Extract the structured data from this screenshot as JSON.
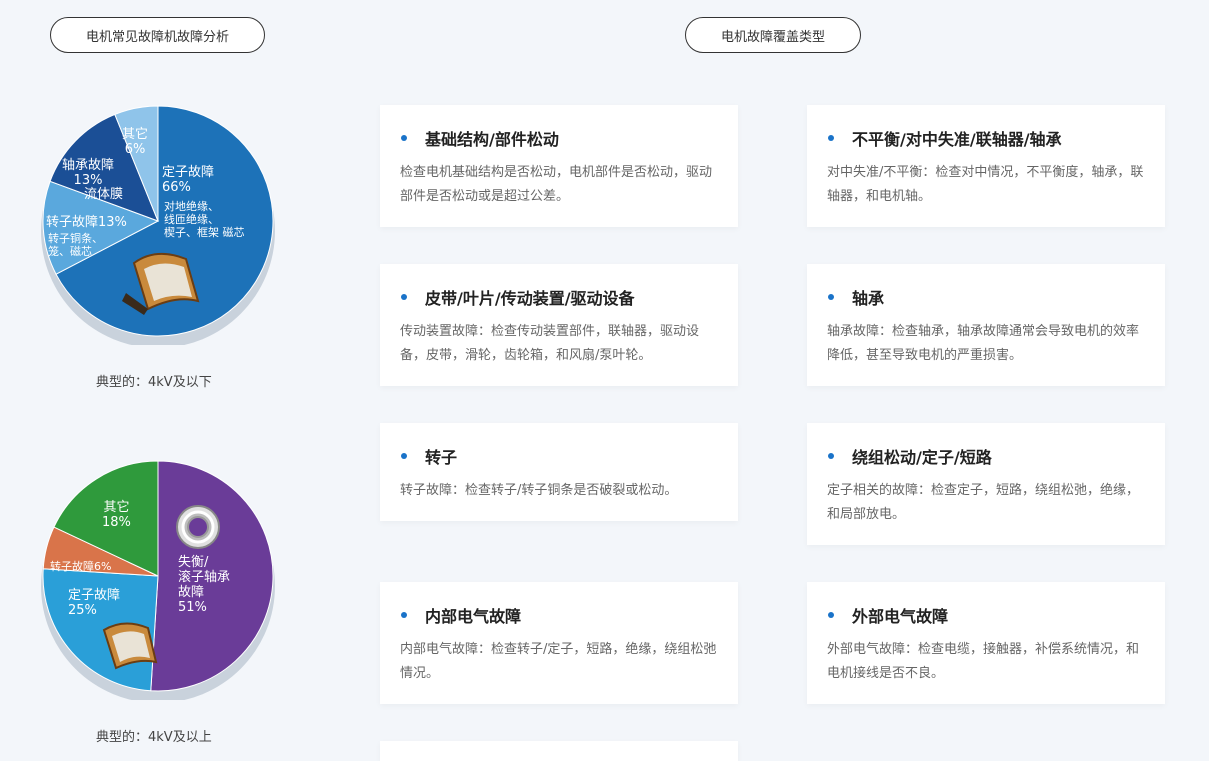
{
  "headers": {
    "left": "电机常见故障机故障分析",
    "right": "电机故障覆盖类型"
  },
  "pie_low": {
    "caption": "典型的：4kV及以下",
    "slices": [
      {
        "name": "定子故障",
        "value": 66,
        "color": "#1d72b8"
      },
      {
        "name": "转子故障",
        "value": 13,
        "color": "#5aa8dd"
      },
      {
        "name": "轴承故障",
        "value": 13,
        "color": "#1b4f96"
      },
      {
        "name": "其它",
        "value": 6,
        "color": "#8fc4ea"
      }
    ],
    "labels": {
      "stator": [
        "定子故障",
        "66%",
        "对地绝缘、",
        "线匝绝缘、",
        "楔子、框架 磁芯"
      ],
      "rotor": [
        "转子故障13%",
        "转子铜条、",
        "笼、磁芯"
      ],
      "bearing": [
        "轴承故障",
        "13%",
        "流体膜"
      ],
      "other": [
        "其它",
        "6%"
      ]
    }
  },
  "pie_high": {
    "caption": "典型的：4kV及以上",
    "slices": [
      {
        "name": "失衡/滚子轴承故障",
        "value": 51,
        "color": "#6a3c98"
      },
      {
        "name": "定子故障",
        "value": 25,
        "color": "#2a9fd8"
      },
      {
        "name": "转子故障",
        "value": 6,
        "color": "#d9744a"
      },
      {
        "name": "其它",
        "value": 18,
        "color": "#2f9a3c"
      }
    ],
    "labels": {
      "imbalance": [
        "失衡/",
        "滚子轴承",
        "故障",
        "51%"
      ],
      "stator": [
        "定子故障",
        "25%"
      ],
      "rotor": [
        "转子故障6%"
      ],
      "other": [
        "其它",
        "18%"
      ]
    }
  },
  "cards": [
    {
      "title": "基础结构/部件松动",
      "desc": "检查电机基础结构是否松动，电机部件是否松动，驱动部件是否松动或是超过公差。"
    },
    {
      "title": "不平衡/对中失准/联轴器/轴承",
      "desc": "对中失准/不平衡：检查对中情况，不平衡度，轴承，联轴器，和电机轴。"
    },
    {
      "title": "皮带/叶片/传动装置/驱动设备",
      "desc": "传动装置故障：检查传动装置部件，联轴器，驱动设备，皮带，滑轮，齿轮箱，和风扇/泵叶轮。"
    },
    {
      "title": "轴承",
      "desc": "轴承故障：检查轴承，轴承故障通常会导致电机的效率降低，甚至导致电机的严重损害。"
    },
    {
      "title": "转子",
      "desc": "转子故障：检查转子/转子铜条是否破裂或松动。"
    },
    {
      "title": "绕组松动/定子/短路",
      "desc": "定子相关的故障：检查定子，短路，绕组松弛，绝缘，和局部放电。"
    },
    {
      "title": "内部电气故障",
      "desc": "内部电气故障：检查转子/定子，短路，绝缘，绕组松弛情况。"
    },
    {
      "title": "外部电气故障",
      "desc": "外部电气故障：检查电缆，接触器，补偿系统情况，和电机接线是否不良。"
    }
  ]
}
